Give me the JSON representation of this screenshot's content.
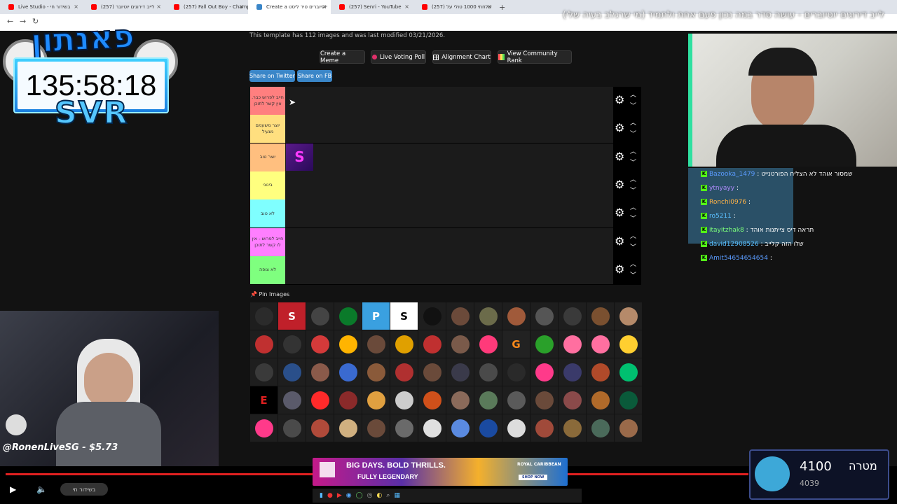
{
  "browser": {
    "tabs": [
      {
        "label": "Live Studio - בשידור חי",
        "color": "#ff0000"
      },
      {
        "label": "(257) לייב דירוגים יוטיובר",
        "color": "#ff0000"
      },
      {
        "label": "(257) Fall Out Boy - Champ",
        "color": "#ff0000"
      },
      {
        "label": "Create a יוטיוברים טיר ליסט",
        "color": "#3a86c8"
      },
      {
        "label": "(257) Senri - YouTube",
        "color": "#ff0000"
      },
      {
        "label": "(257) שלחתי 1000 טולי על",
        "color": "#ff0000"
      }
    ],
    "active_tab": 3,
    "stream_title": "לייב דירוגים יוטיוברים - עושה סדר במה נכון פעם אחת ולתמיד (מי שרגלב בעיה שלי)"
  },
  "page": {
    "meta_text": "This template has 112 images and was last modified 03/21/2026.",
    "buttons": [
      {
        "label": "Create a Meme",
        "icon": "none"
      },
      {
        "label": "Live Voting Poll",
        "icon": "record-dot-icon"
      },
      {
        "label": "Alignment Chart",
        "icon": "grid-icon"
      },
      {
        "label": "View Community Rank",
        "icon": "color-grid-icon"
      }
    ],
    "share_twitter": "Share on Twitter",
    "share_fb": "Share on FB",
    "tiers": [
      {
        "label": "חייב לפרוש כבר. אין קשר לתוכן",
        "color": "#ff7f7f"
      },
      {
        "label": "יוצר משעמם מגעיל",
        "color": "#ffdf7f"
      },
      {
        "label": "יוצר טוב",
        "color": "#ffbf7f"
      },
      {
        "label": "בינוני",
        "color": "#ffff7f"
      },
      {
        "label": "לא טוב",
        "color": "#7fffff"
      },
      {
        "label": "חייב לפרוש - אין לו קשר לתוכן",
        "color": "#ff7fff"
      },
      {
        "label": "לא צופה",
        "color": "#7fff7f"
      }
    ],
    "pin_images": "Pin Images",
    "pool": [
      "#2b2b2b",
      "S",
      "#444",
      "#0a7a2a",
      "P",
      "S",
      "#111",
      "#6b4a3a",
      "#6b6b4a",
      "#a05a3a",
      "#555",
      "#3a3a3a",
      "#7a5030",
      "#b58a6a",
      "#c03030",
      "#333",
      "#d43a3a",
      "#ffb400",
      "#6a4a3a",
      "#e0a000",
      "#c03030",
      "#7a5a4a",
      "#ff3a7a",
      "G",
      "#2aa02a",
      "#ff6fa0",
      "#ff6fa0",
      "#ffcf30",
      "#3a3a3a",
      "#2a4f8a",
      "#8a5a4a",
      "#3a6ad0",
      "#8a5a3a",
      "#b03030",
      "#6a4a3a",
      "#3a3a4a",
      "#4a4a4a",
      "#2a2a2a",
      "#ff3a8a",
      "#3a3a6a",
      "#b04a2a",
      "#00c070",
      "E",
      "#5a5a6a",
      "#ff2a2a",
      "#8a2a2a",
      "#e0a040",
      "#ccc",
      "#d0501a",
      "#8a6a5a",
      "#5a7a5a",
      "#5a5a5a",
      "#6a4a3a",
      "#8a4a4a",
      "#b06a2a",
      "#0a5a3a",
      "#ff3a8a",
      "#4a4a4a",
      "#b04a3a",
      "#d0b080",
      "#6a4a3a",
      "#6a6a6a",
      "#e0e0e0",
      "#5a8ae0",
      "#1a4aa0",
      "#ddd",
      "#a04a3a",
      "#8a6a3a",
      "#4a6a5a",
      "#9a6a4a"
    ],
    "cell_text": [
      "S",
      "P",
      "S",
      "G",
      "E"
    ]
  },
  "overlay": {
    "timer": "135:58:18",
    "logo_text": "פאנתון",
    "svr": "SVR",
    "donation": "@RonenLiveSG - $5.73",
    "goal_value": "4100",
    "goal_sub": "4039",
    "goal_label": "מטרה",
    "ad_line1": "BIG DAYS. BOLD THRILLS.",
    "ad_line2": "FULLY LEGENDARY",
    "ad_brand": "ROYAL CARIBBEAN",
    "ad_cta": "SHOP NOW",
    "live_label": "בשידור חי",
    "progress_fraction": 1.0,
    "chat": [
      {
        "user": "Bazooka_1479",
        "msg": ": שמסור אוהד לא הצליח הפורטנייט",
        "color": "#5b9cff"
      },
      {
        "user": "ytnyayy",
        "msg": ":",
        "color": "#b18cff"
      },
      {
        "user": "Ronchi0976",
        "msg": ":",
        "color": "#ffb347"
      },
      {
        "user": "ro5211",
        "msg": ":",
        "color": "#5bc0ff"
      },
      {
        "user": "itayitzhak8",
        "msg": ": תראה דיס צייתנות אוהד",
        "color": "#7cff7c"
      },
      {
        "user": "david12908526",
        "msg": ": שלו הזה קלייב",
        "color": "#5bc0ff"
      },
      {
        "user": "Amit54654654654",
        "msg": ":",
        "color": "#5b9cff"
      }
    ]
  }
}
